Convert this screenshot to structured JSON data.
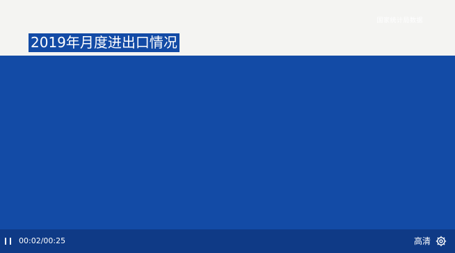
{
  "player": {
    "watermark_text": "国家统计局数据",
    "video_title": "2019年月度进出口情况",
    "controls": {
      "current_time": "00:02",
      "duration": "00:25",
      "time_text": "00:02/00:25",
      "quality_label": "高清",
      "pause_icon": "pause-icon",
      "settings_icon": "gear-icon"
    }
  },
  "colors": {
    "frame_blue": "#134ba6",
    "top_band": "#f4f4f2",
    "control_bar": "#0f3a86",
    "text": "#ffffff"
  }
}
